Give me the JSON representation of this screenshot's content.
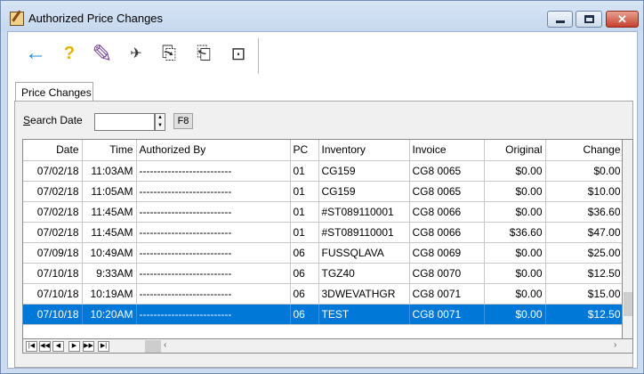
{
  "window": {
    "title": "Authorized Price Changes",
    "min_label": "",
    "max_label": "",
    "close_label": "✕"
  },
  "toolbar": {
    "back_icon": "←",
    "help_icon": "?",
    "eraser_icon": "✎",
    "tool4_icon": "✈",
    "tool5_icon": "⎘",
    "tool6_icon": "⎗",
    "tool7_icon": "⊡"
  },
  "tabs": [
    {
      "label": "Price Changes"
    }
  ],
  "search": {
    "label": "Search Date",
    "value": "",
    "f8_label": "F8"
  },
  "grid": {
    "columns": [
      "Date",
      "Time",
      "Authorized By",
      "PC",
      "Inventory",
      "Invoice",
      "Original",
      "Change"
    ],
    "rows": [
      [
        "07/02/18",
        "11:03AM",
        "--------------------------",
        "01",
        "CG159",
        "CG8 0065",
        "$0.00",
        "$0.00"
      ],
      [
        "07/02/18",
        "11:05AM",
        "--------------------------",
        "01",
        "CG159",
        "CG8 0065",
        "$0.00",
        "$10.00"
      ],
      [
        "07/02/18",
        "11:45AM",
        "--------------------------",
        "01",
        "#ST089110001",
        "CG8 0066",
        "$0.00",
        "$36.60"
      ],
      [
        "07/02/18",
        "11:45AM",
        "--------------------------",
        "01",
        "#ST089110001",
        "CG8 0066",
        "$36.60",
        "$47.00"
      ],
      [
        "07/09/18",
        "10:49AM",
        "--------------------------",
        "06",
        "FUSSQLAVA",
        "CG8 0069",
        "$0.00",
        "$25.00"
      ],
      [
        "07/10/18",
        "9:33AM",
        "--------------------------",
        "06",
        "TGZ40",
        "CG8 0070",
        "$0.00",
        "$12.50"
      ],
      [
        "07/10/18",
        "10:19AM",
        "--------------------------",
        "06",
        "3DWEVATHGR",
        "CG8 0071",
        "$0.00",
        "$15.00"
      ],
      [
        "07/10/18",
        "10:20AM",
        "--------------------------",
        "06",
        "TEST",
        "CG8 0071",
        "$0.00",
        "$12.50"
      ]
    ],
    "selected_row": 7
  },
  "nav": {
    "first": "|◀",
    "prev_page": "◀◀",
    "prev": "◀",
    "next": "▶",
    "next_page": "▶▶",
    "last": "▶|",
    "left_arrow": "‹",
    "right_arrow": "›",
    "up_arrow": "▲",
    "down_arrow": "▼"
  },
  "colors": {
    "selection": "#0078d7",
    "back_arrow": "#1f8ad6",
    "help": "#e2b400"
  }
}
